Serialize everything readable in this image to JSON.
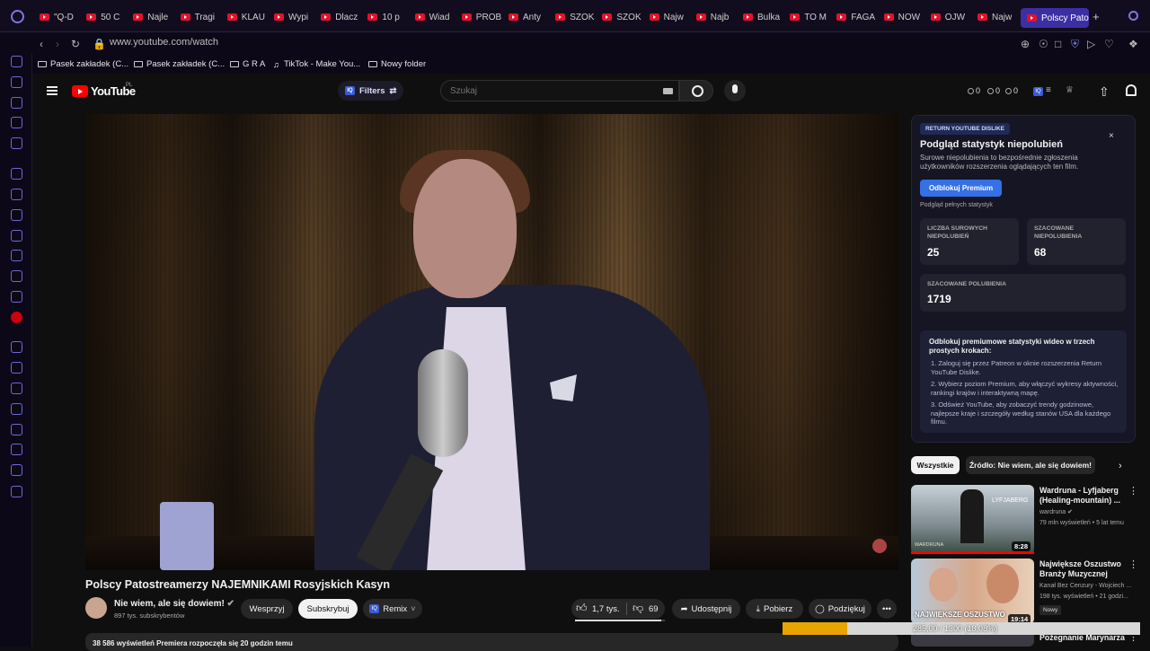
{
  "browser": {
    "tabs": [
      "\"Q-D",
      "50 C",
      "Najle",
      "Tragi",
      "KLAU",
      "Wypi",
      "Dlacz",
      "10 p",
      "Wiad",
      "PROB",
      "Anty",
      "SZOK",
      "SZOK",
      "Najw",
      "Najb",
      "Bulka",
      "TO M",
      "FAGA",
      "NOW",
      "OJW",
      "Najw"
    ],
    "active_tab": "Polscy Pato",
    "new_tab": "+",
    "url": "www.youtube.com/watch",
    "bookmarks": [
      "Pasek zakładek (C...",
      "Pasek zakładek (C...",
      "G R A",
      "TikTok - Make You...",
      "Nowy folder"
    ]
  },
  "yt_header": {
    "logo": "YouTube",
    "logo_region": "PL",
    "filters_label": "Filters",
    "search_placeholder": "Szukaj",
    "stats": [
      "0",
      "0",
      "0"
    ]
  },
  "video": {
    "title": "Polscy Patostreamerzy NAJEMNIKAMI Rosyjskich Kasyn",
    "channel": "Nie wiem, ale się dowiem!",
    "subscribers": "897 tys. subskrybentów",
    "support_label": "Wesprzyj",
    "subscribe_label": "Subskrybuj",
    "remix_label": "Remix",
    "likes": "1,7 tys.",
    "dislikes": "69",
    "like_ratio": 0.96,
    "share_label": "Udostępnij",
    "download_label": "Pobierz",
    "thanks_label": "Podziękuj",
    "more_label": "•••",
    "description": "38 586 wyświetleń  Premiera rozpoczęła się 20 godzin temu"
  },
  "ryd": {
    "badge": "RETURN YOUTUBE DISLIKE",
    "close": "×",
    "title": "Podgląd statystyk niepolubień",
    "description": "Surowe niepolubienia to bezpośrednie zgłoszenia użytkowników rozszerzenia oglądających ten film.",
    "unlock_label": "Odblokuj Premium",
    "full_stats": "Podgląd pełnych statystyk",
    "raw_label": "LICZBA SUROWYCH NIEPOLUBIEŃ",
    "raw_value": "25",
    "est_dislikes_label": "SZACOWANE NIEPOLUBIENIA",
    "est_dislikes_value": "68",
    "est_likes_label": "SZACOWANE POLUBIENIA",
    "est_likes_value": "1719",
    "promo_title": "Odblokuj premiumowe statystyki wideo w trzech prostych krokach:",
    "promo_steps": [
      "1.  Zaloguj się przez Patreon w oknie rozszerzenia Return YouTube Dislike.",
      "2.  Wybierz poziom Premium, aby włączyć wykresy aktywności, rankingi krajów i interaktywną mapę.",
      "3.  Odśwież YouTube, aby zobaczyć trendy godzinowe, najlepsze kraje i szczegóły według stanów USA dla każdego filmu."
    ]
  },
  "recommendations": {
    "chip_all": "Wszystkie",
    "chip_source": "Źródło: Nie wiem, ale się dowiem!",
    "items": [
      {
        "title": "Wardruna - Lyfjaberg (Healing-mountain) ...",
        "channel": "wardruna",
        "meta": "79 mln wyświetleń • 5 lat temu",
        "duration": "8:28",
        "thumb_text": "LYFJABERG",
        "thumb_text2": "WARDRUNA"
      },
      {
        "title": "Największe Oszustwo Branży Muzycznej",
        "channel": "Kanał Bez Cenzury - Wojciech ...",
        "meta": "198 tys. wyświetleń • 21 godzi...",
        "duration": "19:14",
        "badge": "Nowy",
        "thumb_text": "NAJWIĘKSZE OSZUSTWO"
      },
      {
        "title": "Pożegnanie Marynarza",
        "duration": ""
      }
    ]
  },
  "progress": {
    "text": "285,00 / 1300 (18,08%)",
    "fraction": 0.1808
  },
  "colors": {
    "accent": "#3570e6",
    "youtube_red": "#ff0000",
    "browser_accent": "#3c2fa3",
    "progress": "#e8a400"
  }
}
